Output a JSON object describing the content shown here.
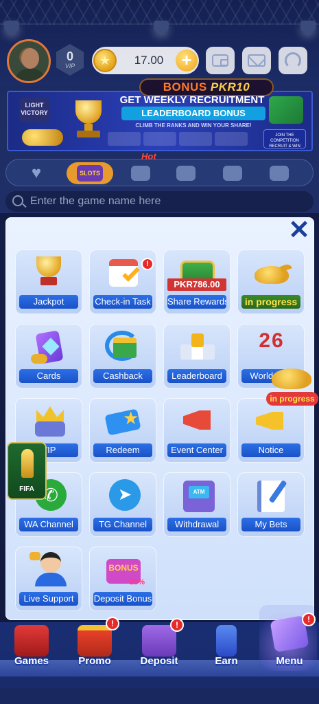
{
  "header": {
    "vip_level": "0",
    "vip_text": "VIP",
    "balance": "17.00",
    "coin_symbol": "★",
    "plus_symbol": "+",
    "bonus_prefix": "BONUS",
    "bonus_amount": "PKR10"
  },
  "banner": {
    "logo_text": "LIGHT VICTORY",
    "title": "GET WEEKLY RECRUITMENT",
    "highlight": "LEADERBOARD BONUS",
    "subtitle": "CLIMB THE RANKS AND WIN YOUR SHARE!",
    "cta": "JOIN THE COMPETITION RECRUIT & WIN TODAY!"
  },
  "tabs": {
    "hot_label": "Hot",
    "active_label": "SLOTS"
  },
  "search": {
    "placeholder": "Enter the game name here"
  },
  "menu": {
    "close_symbol": "✕",
    "pkr_amount": "PKR786.00",
    "tiles": [
      {
        "label": "Jackpot"
      },
      {
        "label": "Check-in Task",
        "badge": "!"
      },
      {
        "label": "Share Rewards"
      },
      {
        "label": "in progress"
      },
      {
        "label": "Cards"
      },
      {
        "label": "Cashback"
      },
      {
        "label": "Leaderboard"
      },
      {
        "label": "World Cup"
      },
      {
        "label": "VIP"
      },
      {
        "label": "Redeem"
      },
      {
        "label": "Event Center"
      },
      {
        "label": "Notice"
      },
      {
        "label": "WA Channel"
      },
      {
        "label": "TG Channel"
      },
      {
        "label": "Withdrawal"
      },
      {
        "label": "My Bets"
      },
      {
        "label": "Live Support"
      },
      {
        "label": "Deposit Bonus"
      }
    ],
    "world_cup_art": "26",
    "atm_text": "ATM",
    "bonus_box_text": "BONUS",
    "bonus_pct": "25%"
  },
  "floating": {
    "fifa_label": "FIFA",
    "lamp_status": "in progress"
  },
  "bottom_nav": {
    "items": [
      {
        "label": "Games"
      },
      {
        "label": "Promo",
        "badge": "!"
      },
      {
        "label": "Deposit",
        "badge": "!"
      },
      {
        "label": "Earn"
      },
      {
        "label": "Menu",
        "badge": "!"
      }
    ]
  },
  "colors": {
    "accent_blue": "#1a52c8",
    "badge_red": "#e62a2a",
    "gold": "#f2b41a"
  }
}
